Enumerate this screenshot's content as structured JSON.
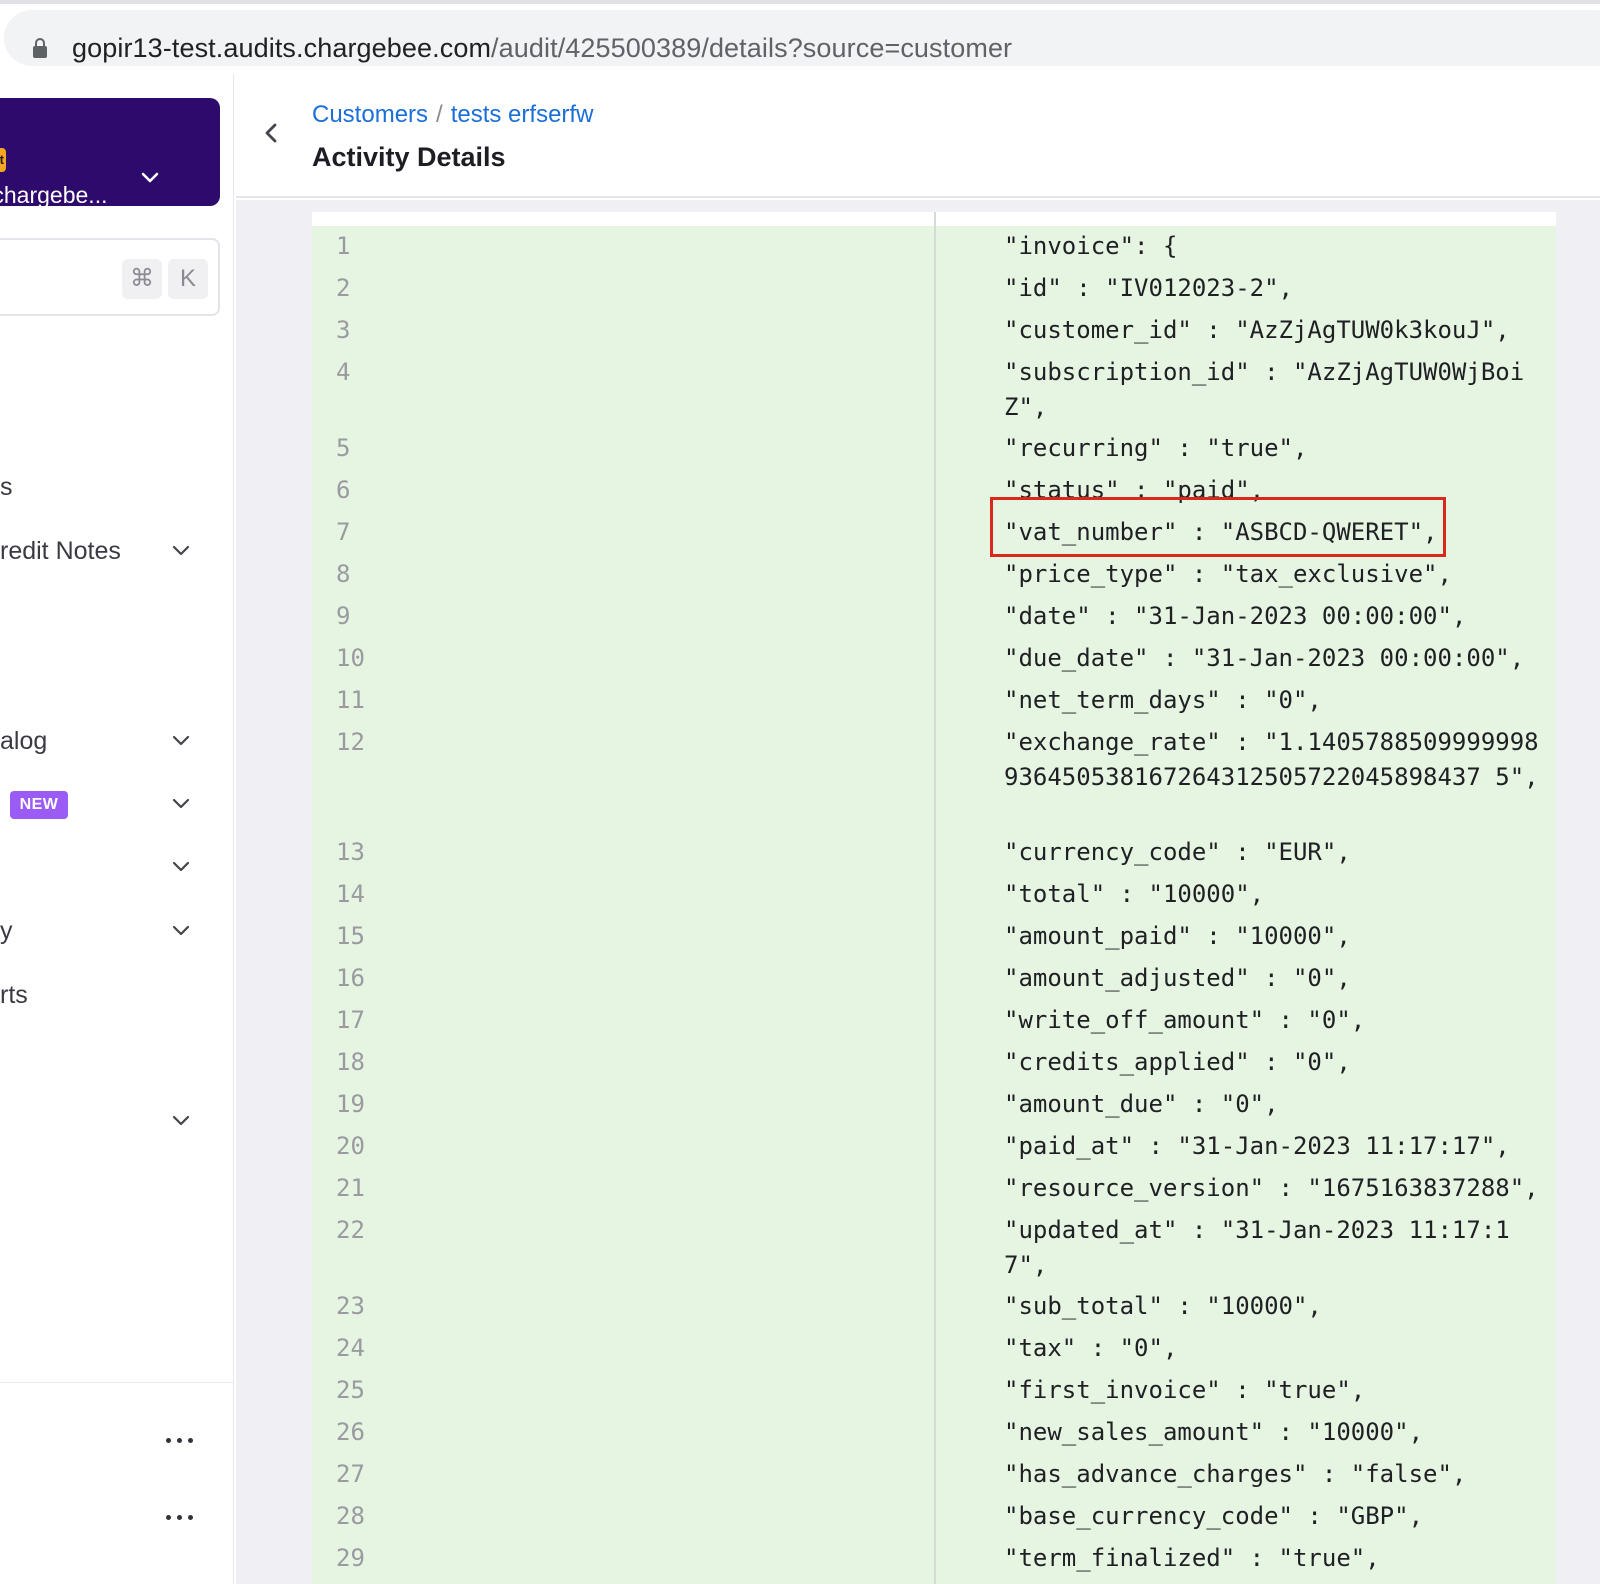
{
  "browser": {
    "url_host": "gopir13-test.audits.chargebee.com",
    "url_path": "/audit/425500389/details?source=customer"
  },
  "sidebar": {
    "site_badge": "st",
    "site_name": ".chargebe...",
    "kbd_cmd": "⌘",
    "kbd_k": "K",
    "items": [
      {
        "label": "s"
      },
      {
        "label": "redit Notes"
      },
      {
        "label": "alog"
      },
      {
        "label": "",
        "badge": "NEW"
      },
      {
        "label": ""
      },
      {
        "label": "y"
      },
      {
        "label": "rts"
      },
      {
        "label": ""
      }
    ]
  },
  "header": {
    "breadcrumb_root": "Customers",
    "breadcrumb_sep": "/",
    "breadcrumb_current": "tests erfserfw",
    "title": "Activity Details"
  },
  "code": {
    "lines": [
      {
        "num": "1",
        "text": "\"invoice\": {"
      },
      {
        "num": "2",
        "text": "\"id\" : \"IV012023-2\","
      },
      {
        "num": "3",
        "text": "\"customer_id\" : \"AzZjAgTUW0k3kouJ\","
      },
      {
        "num": "4",
        "text": "\"subscription_id\" : \"AzZjAgTUW0WjBoiZ\","
      },
      {
        "num": "5",
        "text": "\"recurring\" : \"true\","
      },
      {
        "num": "6",
        "text": "\"status\" : \"paid\","
      },
      {
        "num": "7",
        "text": "\"vat_number\" : \"ASBCD-QWERET\","
      },
      {
        "num": "8",
        "text": "\"price_type\" : \"tax_exclusive\","
      },
      {
        "num": "9",
        "text": "\"date\" : \"31-Jan-2023 00:00:00\","
      },
      {
        "num": "10",
        "text": "\"due_date\" : \"31-Jan-2023 00:00:00\","
      },
      {
        "num": "11",
        "text": "\"net_term_days\" : \"0\","
      },
      {
        "num": "12",
        "text": "\"exchange_rate\" : \"1.1405788509999998936450538167264312505722045898437 5\","
      },
      {
        "num": "13",
        "text": "\"currency_code\" : \"EUR\","
      },
      {
        "num": "14",
        "text": "\"total\" : \"10000\","
      },
      {
        "num": "15",
        "text": "\"amount_paid\" : \"10000\","
      },
      {
        "num": "16",
        "text": "\"amount_adjusted\" : \"0\","
      },
      {
        "num": "17",
        "text": "\"write_off_amount\" : \"0\","
      },
      {
        "num": "18",
        "text": "\"credits_applied\" : \"0\","
      },
      {
        "num": "19",
        "text": "\"amount_due\" : \"0\","
      },
      {
        "num": "20",
        "text": "\"paid_at\" : \"31-Jan-2023 11:17:17\","
      },
      {
        "num": "21",
        "text": "\"resource_version\" : \"1675163837288\","
      },
      {
        "num": "22",
        "text": "\"updated_at\" : \"31-Jan-2023 11:17:17\","
      },
      {
        "num": "23",
        "text": "\"sub_total\" : \"10000\","
      },
      {
        "num": "24",
        "text": "\"tax\" : \"0\","
      },
      {
        "num": "25",
        "text": "\"first_invoice\" : \"true\","
      },
      {
        "num": "26",
        "text": "\"new_sales_amount\" : \"10000\","
      },
      {
        "num": "27",
        "text": "\"has_advance_charges\" : \"false\","
      },
      {
        "num": "28",
        "text": "\"base_currency_code\" : \"GBP\","
      },
      {
        "num": "29",
        "text": "\"term_finalized\" : \"true\","
      }
    ]
  },
  "colors": {
    "brand_purple": "#2d0a6b",
    "link_blue": "#1a6fd8",
    "diff_added_bg": "#e5f5e2",
    "highlight_red": "#d9281c",
    "new_badge": "#9b5cf6",
    "test_badge": "#f5a623"
  }
}
